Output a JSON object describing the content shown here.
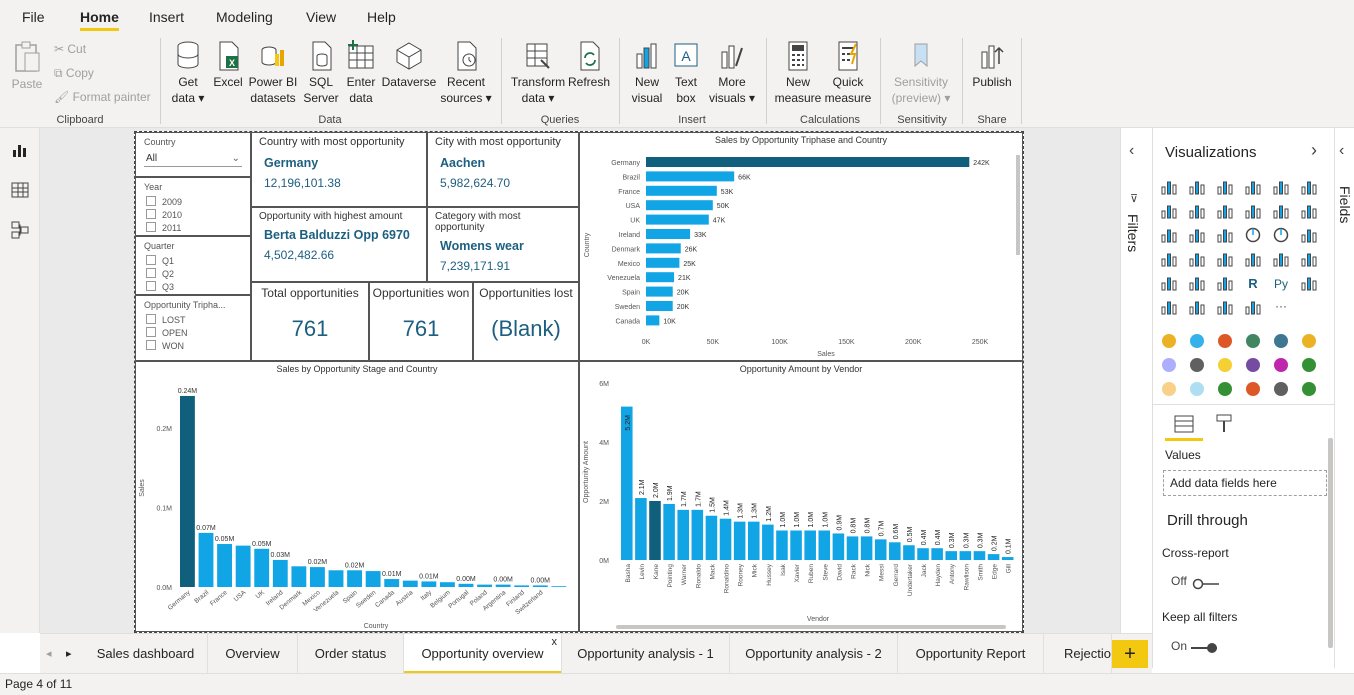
{
  "menu": {
    "tabs": [
      "File",
      "Home",
      "Insert",
      "Modeling",
      "View",
      "Help"
    ],
    "active": "Home"
  },
  "ribbon": {
    "clipboard": {
      "paste": "Paste",
      "cut": "Cut",
      "copy": "Copy",
      "format_painter": "Format painter",
      "label": "Clipboard"
    },
    "data": {
      "get_data": [
        "Get",
        "data ▾"
      ],
      "excel": "Excel",
      "pbi_datasets": [
        "Power BI",
        "datasets"
      ],
      "sql": [
        "SQL",
        "Server"
      ],
      "enter_data": [
        "Enter",
        "data"
      ],
      "dataverse": "Dataverse",
      "recent": [
        "Recent",
        "sources ▾"
      ],
      "label": "Data"
    },
    "queries": {
      "transform": [
        "Transform",
        "data ▾"
      ],
      "refresh": "Refresh",
      "label": "Queries"
    },
    "insert": {
      "new_visual": [
        "New",
        "visual"
      ],
      "text_box": [
        "Text",
        "box"
      ],
      "more_visuals": [
        "More",
        "visuals ▾"
      ],
      "label": "Insert"
    },
    "calculations": {
      "new_measure": [
        "New",
        "measure"
      ],
      "quick_measure": [
        "Quick",
        "measure"
      ],
      "label": "Calculations"
    },
    "sensitivity": {
      "button": [
        "Sensitivity",
        "(preview) ▾"
      ],
      "label": "Sensitivity"
    },
    "share": {
      "publish": "Publish",
      "label": "Share"
    }
  },
  "slicers": {
    "country": {
      "title": "Country",
      "value": "All"
    },
    "year": {
      "title": "Year",
      "items": [
        "2009",
        "2010",
        "2011"
      ]
    },
    "quarter": {
      "title": "Quarter",
      "items": [
        "Q1",
        "Q2",
        "Q3"
      ]
    },
    "triphase": {
      "title": "Opportunity Tripha...",
      "items": [
        "LOST",
        "OPEN",
        "WON"
      ]
    }
  },
  "cards": {
    "country_most": {
      "title": "Country with most opportunity",
      "name": "Germany",
      "value": "12,196,101.38"
    },
    "city_most": {
      "title": "City with most opportunity",
      "name": "Aachen",
      "value": "5,982,624.70"
    },
    "highest_amount": {
      "title": "Opportunity with highest amount",
      "name": "Berta Balduzzi Opp 6970",
      "value": "4,502,482.66"
    },
    "category_most": {
      "title": "Category with most opportunity",
      "name": "Womens wear",
      "value": "7,239,171.91"
    },
    "total": {
      "title": "Total opportunities",
      "value": "761"
    },
    "won": {
      "title": "Opportunities won",
      "value": "761"
    },
    "lost": {
      "title": "Opportunities lost",
      "value": "(Blank)"
    }
  },
  "chart_data": [
    {
      "type": "bar",
      "orientation": "horizontal",
      "title": "Sales by Opportunity Triphase and Country",
      "xlabel": "Sales",
      "ylabel": "Country",
      "categories": [
        "Germany",
        "Brazil",
        "France",
        "USA",
        "UK",
        "Ireland",
        "Denmark",
        "Mexico",
        "Venezuela",
        "Spain",
        "Sweden",
        "Canada"
      ],
      "values": [
        242000,
        66000,
        53000,
        50000,
        47000,
        33000,
        26000,
        25000,
        21000,
        20000,
        20000,
        10000
      ],
      "data_labels": [
        "242K",
        "66K",
        "53K",
        "50K",
        "47K",
        "33K",
        "26K",
        "25K",
        "21K",
        "20K",
        "20K",
        "10K"
      ],
      "x_ticks": [
        "0K",
        "50K",
        "100K",
        "150K",
        "200K",
        "250K"
      ],
      "xlim": [
        0,
        250000
      ]
    },
    {
      "type": "bar",
      "title": "Sales by Opportunity Stage and Country",
      "xlabel": "Country",
      "ylabel": "Sales",
      "categories": [
        "Germany",
        "Brazil",
        "France",
        "USA",
        "UK",
        "Ireland",
        "Denmark",
        "Mexico",
        "Venezuela",
        "Spain",
        "Sweden",
        "Canada",
        "Austria",
        "Italy",
        "Belgium",
        "Portugal",
        "Poland",
        "Argentina",
        "Finland",
        "Switzerland",
        ""
      ],
      "values": [
        0.24,
        0.068,
        0.054,
        0.052,
        0.048,
        0.034,
        0.026,
        0.025,
        0.021,
        0.021,
        0.02,
        0.01,
        0.008,
        0.007,
        0.006,
        0.004,
        0.003,
        0.003,
        0.002,
        0.002,
        0.001
      ],
      "data_labels": [
        "0.24M",
        "0.07M",
        "0.05M",
        "",
        "0.05M",
        "0.03M",
        "",
        "0.02M",
        "",
        "0.02M",
        "",
        "0.01M",
        "",
        "0.01M",
        "",
        "0.00M",
        "",
        "0.00M",
        "",
        "0.00M",
        ""
      ],
      "y_ticks": [
        "0.0M",
        "0.1M",
        "0.2M"
      ],
      "ylim": [
        0,
        0.25
      ]
    },
    {
      "type": "bar",
      "title": "Opportunity Amount by Vendor",
      "xlabel": "Vendor",
      "ylabel": "Opportunity Amount",
      "categories": [
        "Basha",
        "Levin",
        "Kane",
        "Pointing",
        "Warner",
        "Ronaldo",
        "Mack",
        "Ronaldino",
        "Rooney",
        "Mick",
        "Hussey",
        "Isak",
        "Xavier",
        "Ruben",
        "Steve",
        "David",
        "Rack",
        "Nick",
        "Messi",
        "Gerrard",
        "Undertaker",
        "Jack",
        "Hayden",
        "Antony",
        "Rawlison",
        "Smith",
        "Edge",
        "Gill"
      ],
      "values": [
        5.2,
        2.1,
        2.0,
        1.9,
        1.7,
        1.7,
        1.5,
        1.4,
        1.3,
        1.3,
        1.2,
        1.0,
        1.0,
        1.0,
        1.0,
        0.9,
        0.8,
        0.8,
        0.7,
        0.6,
        0.5,
        0.4,
        0.4,
        0.3,
        0.3,
        0.3,
        0.2,
        0.1
      ],
      "data_labels": [
        "5.2M",
        "2.1M",
        "2.0M",
        "1.9M",
        "1.7M",
        "1.7M",
        "1.5M",
        "1.4M",
        "1.3M",
        "1.3M",
        "1.2M",
        "1.0M",
        "1.0M",
        "1.0M",
        "1.0M",
        "0.9M",
        "0.8M",
        "0.8M",
        "0.7M",
        "0.6M",
        "0.5M",
        "0.4M",
        "0.4M",
        "0.3M",
        "0.3M",
        "0.3M",
        "0.2M",
        "0.1M"
      ],
      "y_ticks": [
        "0M",
        "2M",
        "4M",
        "6M"
      ],
      "ylim": [
        0,
        6
      ]
    }
  ],
  "colors": {
    "dark_bar": "#0f5f7d",
    "bar": "#12a5e6",
    "accent": "#f2c811",
    "card_text": "#1d5f80"
  },
  "panes": {
    "filters": "Filters",
    "visualizations": "Visualizations",
    "fields": "Fields",
    "values_label": "Values",
    "add_fields": "Add data fields here",
    "drill_through": "Drill through",
    "cross_report": "Cross-report",
    "cross_report_state": "Off",
    "keep_filters": "Keep all filters",
    "keep_filters_state": "On"
  },
  "page_tabs": [
    "Sales dashboard",
    "Overview",
    "Order status",
    "Opportunity overview",
    "Opportunity analysis - 1",
    "Opportunity analysis - 2",
    "Opportunity Report",
    "Rejection"
  ],
  "active_tab": "Opportunity overview",
  "status": "Page 4 of 11"
}
